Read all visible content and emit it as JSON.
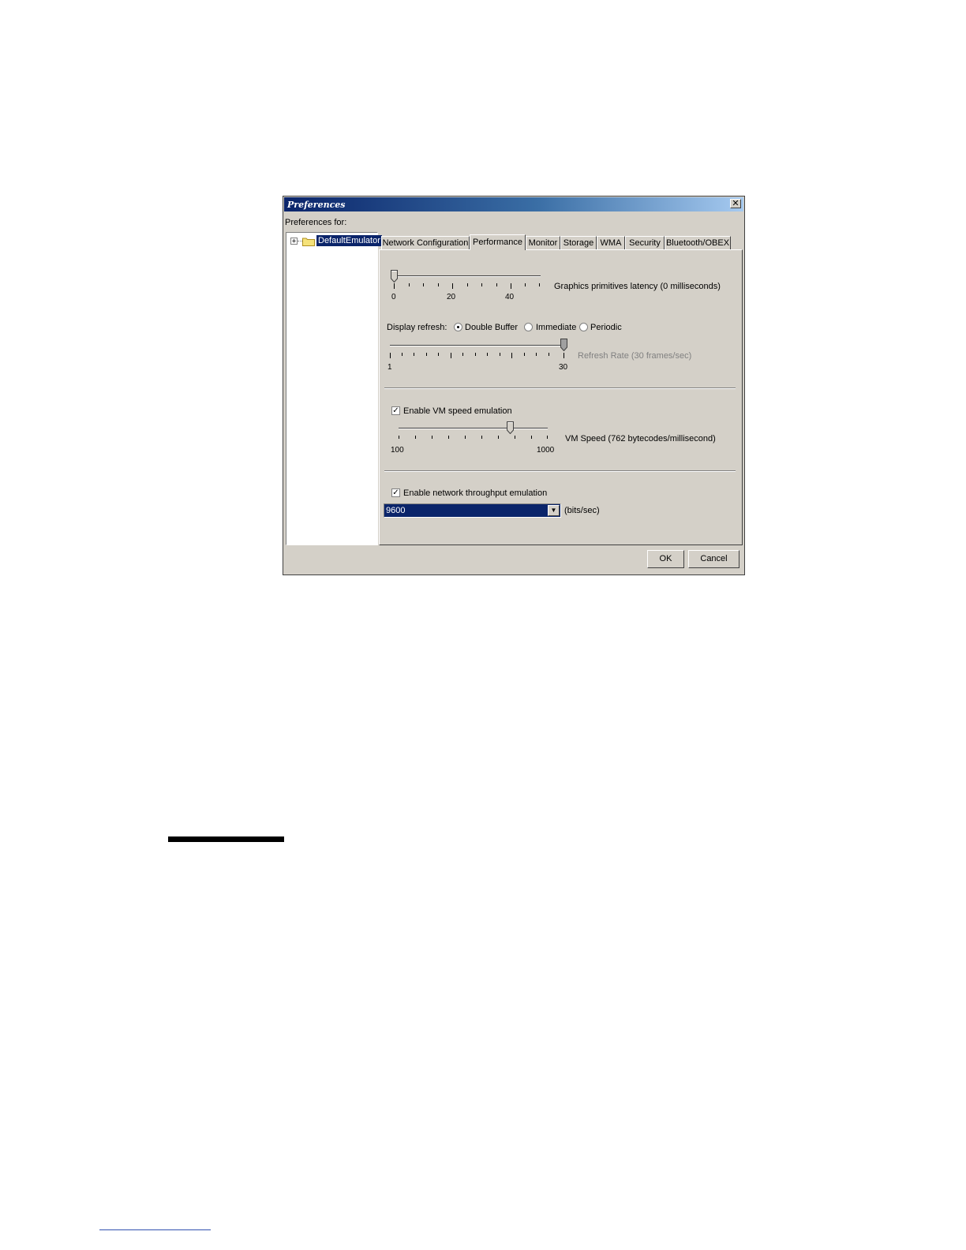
{
  "dialog": {
    "title": "Preferences",
    "close_glyph": "✕",
    "preferences_for_label": "Preferences for:",
    "tree": {
      "expander": "+",
      "selected_node": "DefaultEmulator"
    },
    "tabs": [
      {
        "label": "Network Configuration",
        "active": false
      },
      {
        "label": "Performance",
        "active": true
      },
      {
        "label": "Monitor",
        "active": false
      },
      {
        "label": "Storage",
        "active": false
      },
      {
        "label": "WMA",
        "active": false
      },
      {
        "label": "Security",
        "active": false
      },
      {
        "label": "Bluetooth/OBEX",
        "active": false
      }
    ],
    "performance": {
      "latency_slider": {
        "value": 0,
        "tick_labels": [
          "0",
          "20",
          "40"
        ],
        "label": "Graphics primitives latency (0 milliseconds)"
      },
      "display_refresh": {
        "label": "Display refresh:",
        "options": [
          "Double Buffer",
          "Immediate",
          "Periodic"
        ],
        "selected": "Double Buffer"
      },
      "refresh_slider": {
        "value": 30,
        "min_label": "1",
        "max_label": "30",
        "label": "Refresh Rate (30 frames/sec)",
        "enabled": false
      },
      "vm_speed": {
        "checkbox_label": "Enable VM speed emulation",
        "checked": true,
        "value": 762,
        "min_label": "100",
        "max_label": "1000",
        "label": "VM Speed (762 bytecodes/millisecond)"
      },
      "network_throughput": {
        "checkbox_label": "Enable network throughput emulation",
        "checked": true,
        "selected_value": "9600",
        "unit_label": "(bits/sec)"
      }
    },
    "buttons": {
      "ok": "OK",
      "cancel": "Cancel"
    }
  },
  "icons": {
    "folder": "folder-icon",
    "dropdown": "dropdown-arrow-icon",
    "check": "✓",
    "arrow": "▼"
  },
  "colors": {
    "title_start": "#0a246a",
    "title_end": "#a6caf0",
    "face": "#d4d0c8",
    "selection": "#0a246a"
  }
}
